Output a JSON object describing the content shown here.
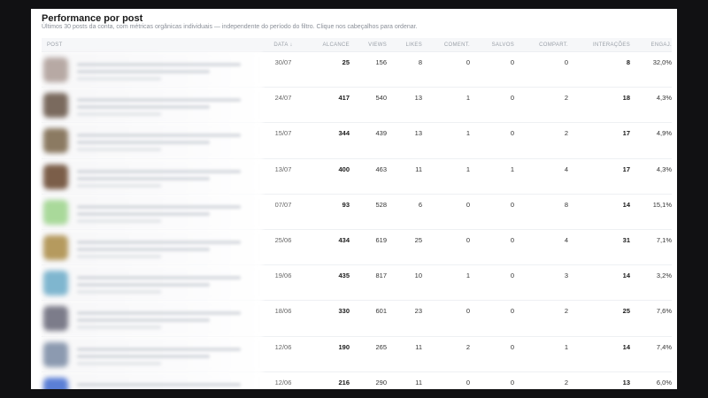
{
  "title": "Performance por post",
  "subtitle": "Últimos 30 posts da conta, com métricas orgânicas individuais — independente do período do filtro. Clique nos cabeçalhos para ordenar.",
  "columns": {
    "post": "POST",
    "data": "DATA ↓",
    "alcance": "ALCANCE",
    "views": "VIEWS",
    "likes": "LIKES",
    "coment": "COMENT.",
    "salvos": "SALVOS",
    "compart": "COMPART.",
    "interacoes": "INTERAÇÕES",
    "engaj": "ENGAJ."
  },
  "thumb_colors": [
    "#b7a9a4",
    "#7a6a5e",
    "#8b7a62",
    "#7b5e49",
    "#a9d99a",
    "#b59a5e",
    "#7fb6cf",
    "#7c7c8a",
    "#8c9ab0",
    "#5b7fd6"
  ],
  "rows": [
    {
      "data": "30/07",
      "alcance": "25",
      "views": "156",
      "likes": "8",
      "coment": "0",
      "salvos": "0",
      "compart": "0",
      "interacoes": "8",
      "engaj": "32,0%"
    },
    {
      "data": "24/07",
      "alcance": "417",
      "views": "540",
      "likes": "13",
      "coment": "1",
      "salvos": "0",
      "compart": "2",
      "interacoes": "18",
      "engaj": "4,3%"
    },
    {
      "data": "15/07",
      "alcance": "344",
      "views": "439",
      "likes": "13",
      "coment": "1",
      "salvos": "0",
      "compart": "2",
      "interacoes": "17",
      "engaj": "4,9%"
    },
    {
      "data": "13/07",
      "alcance": "400",
      "views": "463",
      "likes": "11",
      "coment": "1",
      "salvos": "1",
      "compart": "4",
      "interacoes": "17",
      "engaj": "4,3%"
    },
    {
      "data": "07/07",
      "alcance": "93",
      "views": "528",
      "likes": "6",
      "coment": "0",
      "salvos": "0",
      "compart": "8",
      "interacoes": "14",
      "engaj": "15,1%"
    },
    {
      "data": "25/06",
      "alcance": "434",
      "views": "619",
      "likes": "25",
      "coment": "0",
      "salvos": "0",
      "compart": "4",
      "interacoes": "31",
      "engaj": "7,1%"
    },
    {
      "data": "19/06",
      "alcance": "435",
      "views": "817",
      "likes": "10",
      "coment": "1",
      "salvos": "0",
      "compart": "3",
      "interacoes": "14",
      "engaj": "3,2%"
    },
    {
      "data": "18/06",
      "alcance": "330",
      "views": "601",
      "likes": "23",
      "coment": "0",
      "salvos": "0",
      "compart": "2",
      "interacoes": "25",
      "engaj": "7,6%"
    },
    {
      "data": "12/06",
      "alcance": "190",
      "views": "265",
      "likes": "11",
      "coment": "2",
      "salvos": "0",
      "compart": "1",
      "interacoes": "14",
      "engaj": "7,4%"
    },
    {
      "data": "12/06",
      "alcance": "216",
      "views": "290",
      "likes": "11",
      "coment": "0",
      "salvos": "0",
      "compart": "2",
      "interacoes": "13",
      "engaj": "6,0%"
    }
  ]
}
